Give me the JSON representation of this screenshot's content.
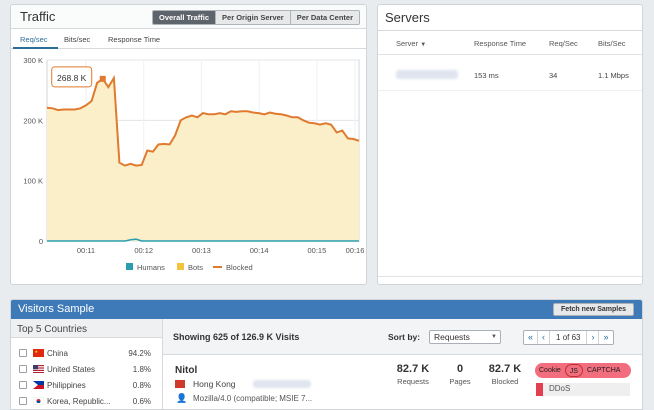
{
  "traffic": {
    "title": "Traffic",
    "views": [
      "Overall Traffic",
      "Per Origin Server",
      "Per Data Center"
    ],
    "active_view": "Overall Traffic",
    "tabs": [
      "Req/sec",
      "Bits/sec",
      "Response Time"
    ],
    "active_tab": "Req/sec",
    "tooltip": "268.8 K"
  },
  "chart_data": {
    "type": "line",
    "y_ticks": [
      "300 K",
      "200 K",
      "100 K",
      "0"
    ],
    "ylim": [
      0,
      300000
    ],
    "x_ticks": [
      "00:11",
      "00:12",
      "00:13",
      "00:14",
      "00:15",
      "00:16"
    ],
    "legend": [
      "Humans",
      "Bots",
      "Blocked"
    ],
    "legend_position": "bottom",
    "grid": true,
    "colors": {
      "humans": "#2a9db0",
      "bots": "#f2c43d",
      "blocked": "#e07a2e",
      "bots_fill": "#fbefc9"
    },
    "series": [
      {
        "name": "Blocked",
        "values": [
          221000,
          220000,
          217000,
          218000,
          218000,
          218000,
          220000,
          225000,
          232000,
          262000,
          268800,
          255000,
          270000,
          130000,
          125000,
          128000,
          125000,
          126000,
          150000,
          148000,
          160000,
          161000,
          160000,
          175000,
          200000,
          205000,
          208000,
          205000,
          212000,
          210000,
          210000,
          212000,
          210000,
          215000,
          214000,
          215000,
          215000,
          213000,
          212000,
          210000,
          213000,
          211000,
          210000,
          208000,
          205000,
          205000,
          200000,
          196000,
          195000,
          193000,
          195000,
          193000,
          180000,
          183000,
          170000,
          169000,
          166000
        ]
      },
      {
        "name": "Bots",
        "values": [
          221000,
          220000,
          217000,
          218000,
          218000,
          218000,
          220000,
          225000,
          232000,
          262000,
          268800,
          255000,
          270000,
          130000,
          125000,
          128000,
          125000,
          126000,
          150000,
          148000,
          160000,
          161000,
          160000,
          175000,
          200000,
          205000,
          208000,
          205000,
          212000,
          210000,
          210000,
          212000,
          210000,
          215000,
          214000,
          215000,
          215000,
          213000,
          212000,
          210000,
          213000,
          211000,
          210000,
          208000,
          205000,
          205000,
          200000,
          196000,
          195000,
          193000,
          195000,
          193000,
          180000,
          183000,
          170000,
          169000,
          166000
        ]
      },
      {
        "name": "Humans",
        "values": [
          0,
          0,
          0,
          0,
          0,
          0,
          0,
          0,
          0,
          0,
          0,
          0,
          0,
          0,
          0,
          2000,
          3000,
          0,
          0,
          0,
          0,
          0,
          0,
          0,
          0,
          0,
          0,
          0,
          0,
          0,
          0,
          0,
          0,
          0,
          0,
          0,
          0,
          0,
          0,
          0,
          0,
          0,
          0,
          0,
          0,
          0,
          0,
          0,
          0,
          0,
          0,
          0,
          0,
          0,
          0,
          0,
          0
        ]
      }
    ]
  },
  "servers": {
    "title": "Servers",
    "columns": [
      "Server",
      "Response Time",
      "Req/Sec",
      "Bits/Sec"
    ],
    "rows": [
      {
        "response_time": "153 ms",
        "req_sec": "34",
        "bits_sec": "1.1 Mbps"
      }
    ]
  },
  "visitors": {
    "title": "Visitors Sample",
    "fetch_label": "Fetch new Samples",
    "top_countries_title": "Top 5 Countries",
    "countries": [
      {
        "name": "China",
        "pct": "94.2%"
      },
      {
        "name": "United States",
        "pct": "1.8%"
      },
      {
        "name": "Philippines",
        "pct": "0.8%"
      },
      {
        "name": "Korea, Republic...",
        "pct": "0.6%"
      }
    ],
    "showing": "Showing 625 of 126.9 K Visits",
    "sort_label": "Sort by:",
    "sort_value": "Requests",
    "pager": {
      "first": "«",
      "prev": "‹",
      "page": "1 of 63",
      "next": "›",
      "last": "»"
    },
    "sample": {
      "name": "Nitol",
      "location": "Hong Kong",
      "user_agent": "Mozilla/4.0 (compatible; MSIE 7...",
      "requests": "82.7 K",
      "requests_label": "Requests",
      "pages": "0",
      "pages_label": "Pages",
      "blocked": "82.7 K",
      "blocked_label": "Blocked",
      "challenges": [
        "Cookie",
        "JS",
        "CAPTCHA"
      ],
      "threat": "DDoS"
    }
  }
}
